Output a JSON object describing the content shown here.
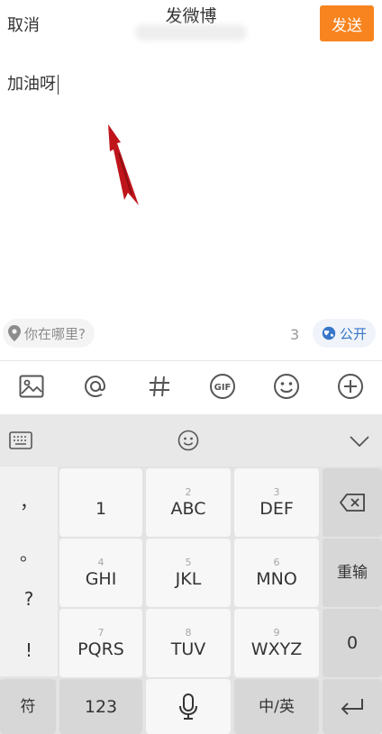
{
  "header": {
    "cancel": "取消",
    "title": "发微博",
    "send": "发送"
  },
  "compose": {
    "text": "加油呀"
  },
  "location": {
    "label": "你在哪里?"
  },
  "counter": "3",
  "visibility": {
    "label": "公开"
  },
  "toolbar": {
    "items": [
      {
        "icon": "image-icon"
      },
      {
        "icon": "at-icon"
      },
      {
        "icon": "hashtag-icon"
      },
      {
        "icon": "gif-icon",
        "label": "GIF"
      },
      {
        "icon": "emoji-icon"
      },
      {
        "icon": "plus-circle-icon"
      }
    ]
  },
  "keyboard": {
    "symbols": [
      "，",
      "。",
      "?",
      "!"
    ],
    "keys": [
      {
        "num": "",
        "label": "1"
      },
      {
        "num": "2",
        "label": "ABC"
      },
      {
        "num": "3",
        "label": "DEF"
      },
      {
        "num": "4",
        "label": "GHI"
      },
      {
        "num": "5",
        "label": "JKL"
      },
      {
        "num": "6",
        "label": "MNO"
      },
      {
        "num": "7",
        "label": "PQRS"
      },
      {
        "num": "8",
        "label": "TUV"
      },
      {
        "num": "9",
        "label": "WXYZ"
      }
    ],
    "retype": "重输",
    "zero": "0",
    "bottom": {
      "symbol": "符",
      "numbers": "123",
      "lang": "中/英"
    }
  },
  "colors": {
    "accent": "#f7841f",
    "link": "#3776c8",
    "arrow": "#c0141b"
  }
}
